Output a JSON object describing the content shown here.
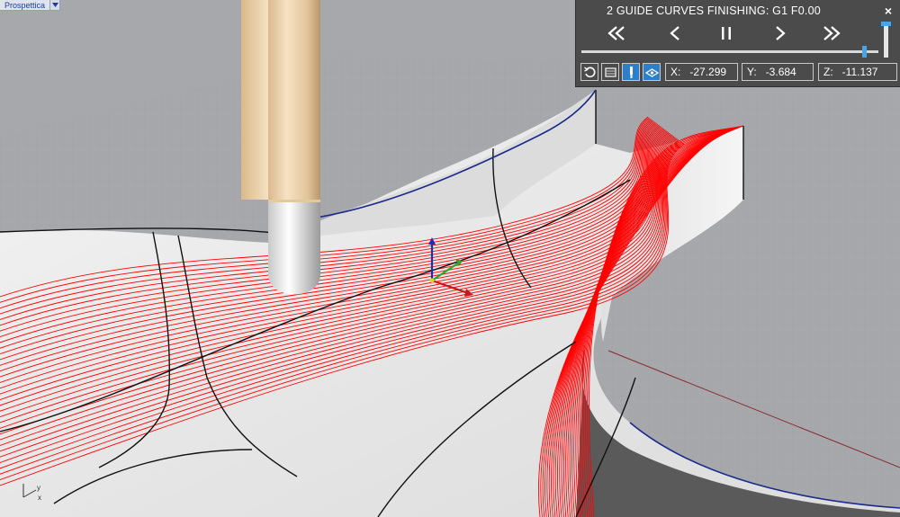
{
  "viewport": {
    "name": "Prospettica",
    "axis_x": "x",
    "axis_y": "y"
  },
  "simulation": {
    "title": "2 GUIDE CURVES FINISHING: G1 F0.00",
    "close_label": "×",
    "progress": 0.96,
    "speed": 1.0,
    "coords": {
      "x_label": "X:",
      "x_value": "-27.299",
      "y_label": "Y:",
      "y_value": "-3.684",
      "z_label": "Z:",
      "z_value": "-11.137"
    }
  },
  "colors": {
    "toolpath": "#ff0000",
    "panel_bg": "#4b4b4b",
    "accent": "#48a6e8",
    "tool_shank": "#e8cfa8",
    "edge_blue": "#1a2a8a"
  },
  "icons": [
    "rewind-icon",
    "step-back-icon",
    "pause-icon",
    "step-forward-icon",
    "fast-forward-icon",
    "reset-icon",
    "stock-icon",
    "tool-icon",
    "surface-icon",
    "close-icon"
  ]
}
